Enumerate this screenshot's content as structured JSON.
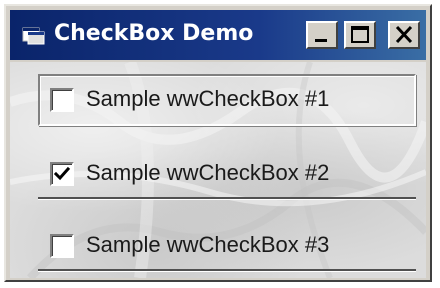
{
  "window": {
    "title": "CheckBox Demo",
    "icon": "app-window-icon",
    "controls": {
      "minimize_icon": "minimize-icon",
      "maximize_icon": "maximize-icon",
      "close_icon": "close-icon"
    },
    "colors": {
      "titlebar_start": "#0a246a",
      "titlebar_end": "#3a6ea5",
      "face": "#d4d0c8"
    }
  },
  "checkboxes": [
    {
      "label": "Sample wwCheckBox #1",
      "checked": false,
      "focused": true
    },
    {
      "label": "Sample wwCheckBox #2",
      "checked": true,
      "focused": false
    },
    {
      "label": "Sample wwCheckBox #3",
      "checked": false,
      "focused": false
    }
  ]
}
